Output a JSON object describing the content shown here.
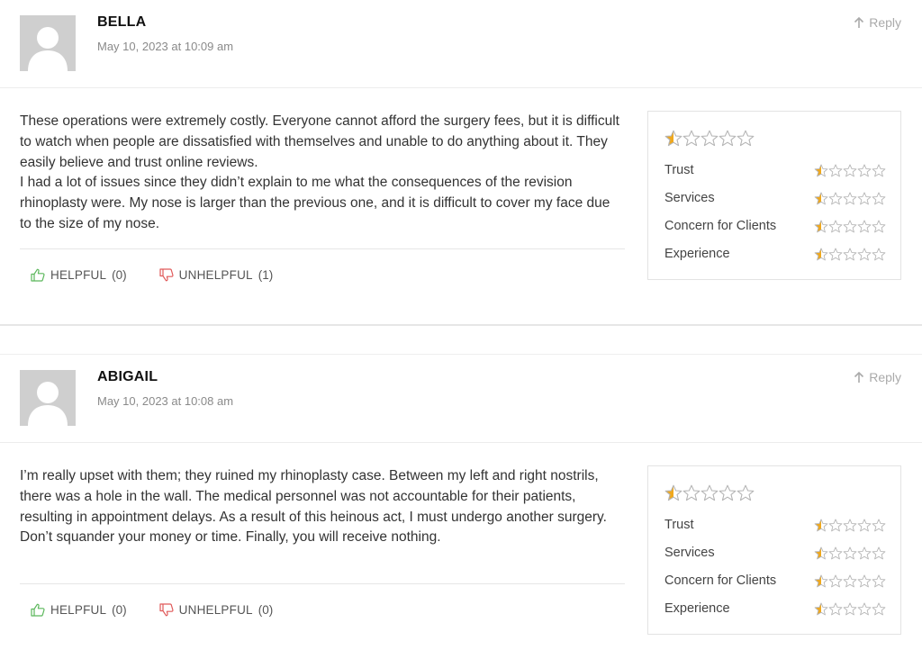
{
  "colors": {
    "star_fill": "#f0a81c",
    "star_outline": "#b5b5b5",
    "helpful": "#5cb85c",
    "unhelpful": "#e05a5a",
    "muted": "#aaaaaa"
  },
  "icons": {
    "avatar": "person-silhouette-icon",
    "reply": "arrow-up-icon",
    "helpful": "thumbs-up-icon",
    "unhelpful": "thumbs-down-icon",
    "star": "star-icon"
  },
  "reviews": [
    {
      "author": "BELLA",
      "date": "May 10, 2023 at 10:09 am",
      "reply_label": "Reply",
      "body": [
        "These operations were extremely costly. Everyone cannot afford the surgery fees, but it is difficult to watch when people are dissatisfied with themselves and unable to do anything about it. They easily believe and trust online reviews.",
        "I had a lot of issues since they didn’t explain to me what the consequences of the revision rhinoplasty were. My nose is larger than the previous one, and it is difficult to cover my face due to the size of my nose."
      ],
      "helpful_label": "HELPFUL",
      "helpful_count": "(0)",
      "unhelpful_label": "UNHELPFUL",
      "unhelpful_count": "(1)",
      "overall_rating": 0.5,
      "ratings": [
        {
          "name": "Trust",
          "value": 0.5
        },
        {
          "name": "Services",
          "value": 0.5
        },
        {
          "name": "Concern for Clients",
          "value": 0.5
        },
        {
          "name": "Experience",
          "value": 0.5
        }
      ]
    },
    {
      "author": "ABIGAIL",
      "date": "May 10, 2023 at 10:08 am",
      "reply_label": "Reply",
      "body": [
        "I’m really upset with them; they ruined my rhinoplasty case. Between my left and right nostrils, there was a hole in the wall. The medical personnel was not accountable for their patients, resulting in appointment delays. As a result of this heinous act, I must undergo another surgery.",
        "Don’t squander your money or time. Finally, you will receive nothing."
      ],
      "helpful_label": "HELPFUL",
      "helpful_count": "(0)",
      "unhelpful_label": "UNHELPFUL",
      "unhelpful_count": "(0)",
      "overall_rating": 0.5,
      "ratings": [
        {
          "name": "Trust",
          "value": 0.5
        },
        {
          "name": "Services",
          "value": 0.5
        },
        {
          "name": "Concern for Clients",
          "value": 0.5
        },
        {
          "name": "Experience",
          "value": 0.5
        }
      ]
    }
  ]
}
